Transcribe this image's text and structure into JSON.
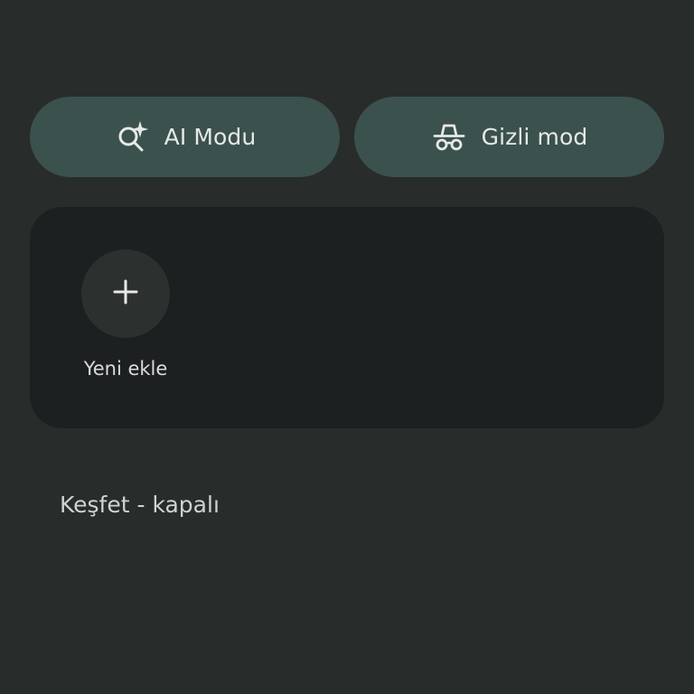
{
  "quick_actions": {
    "ai_mode": {
      "label": "AI Modu",
      "icon": "ai-search-sparkle-icon"
    },
    "incognito": {
      "label": "Gizli mod",
      "icon": "incognito-icon"
    }
  },
  "shortcuts": {
    "add_new": {
      "label": "Yeni ekle",
      "icon": "plus-icon"
    }
  },
  "discover": {
    "status_text": "Keşfet - kapalı"
  },
  "colors": {
    "background": "#282c2b",
    "pill": "#3b514d",
    "card": "#1d2020",
    "text": "#e6e9e7"
  }
}
